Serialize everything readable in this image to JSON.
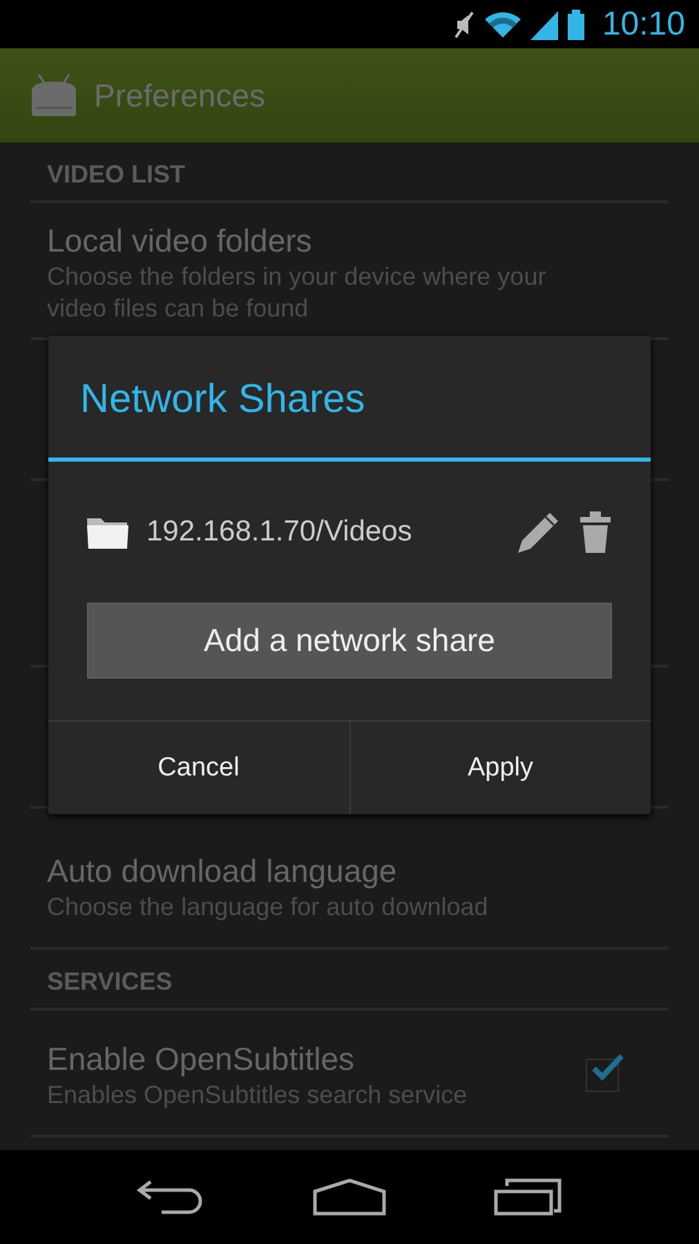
{
  "status_bar": {
    "time": "10:10"
  },
  "action_bar": {
    "title": "Preferences"
  },
  "sections": [
    {
      "header": "VIDEO LIST",
      "items": [
        {
          "title": "Local video folders",
          "summary": "Choose the folders in your device where your video files can be found"
        }
      ]
    },
    {
      "items": [
        {
          "title": "Auto download language",
          "summary": "Choose the language for auto download"
        }
      ]
    },
    {
      "header": "SERVICES",
      "items": [
        {
          "title": "Enable OpenSubtitles",
          "summary": "Enables OpenSubtitles search service",
          "kind": "checkbox",
          "checked": true
        }
      ]
    }
  ],
  "dialog": {
    "title": "Network Shares",
    "shares": [
      {
        "path": "192.168.1.70/Videos"
      }
    ],
    "add_button": "Add a network share",
    "buttons": [
      "Cancel",
      "Apply"
    ]
  }
}
